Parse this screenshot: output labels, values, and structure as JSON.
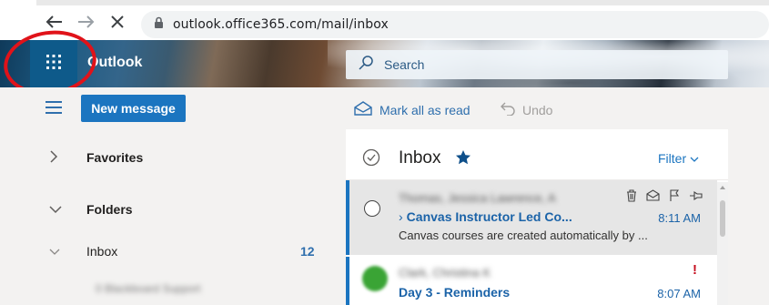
{
  "browser": {
    "url": "outlook.office365.com/mail/inbox"
  },
  "header": {
    "brand": "Outlook",
    "search_placeholder": "Search"
  },
  "toolbar": {
    "new_message_label": "New message",
    "mark_all_read_label": "Mark all as read",
    "undo_label": "Undo"
  },
  "leftnav": {
    "favorites_label": "Favorites",
    "folders_label": "Folders",
    "inbox_label": "Inbox",
    "inbox_count": "12",
    "subfolder_label": "0 Blackboard Support"
  },
  "message_list": {
    "title": "Inbox",
    "filter_label": "Filter",
    "messages": [
      {
        "sender": "Thomas, Jessica Lawrence, A",
        "subject": "Canvas Instructor Led Co...",
        "time": "8:11 AM",
        "preview": "Canvas courses are created automatically by ..."
      },
      {
        "sender": "Clark, Christina K",
        "subject": "Day 3 - Reminders",
        "time": "8:07 AM",
        "flag": "!"
      }
    ]
  },
  "colors": {
    "accent": "#1b75c0",
    "launcher_bg": "#0e5a8a",
    "annotation": "#e0131a"
  }
}
